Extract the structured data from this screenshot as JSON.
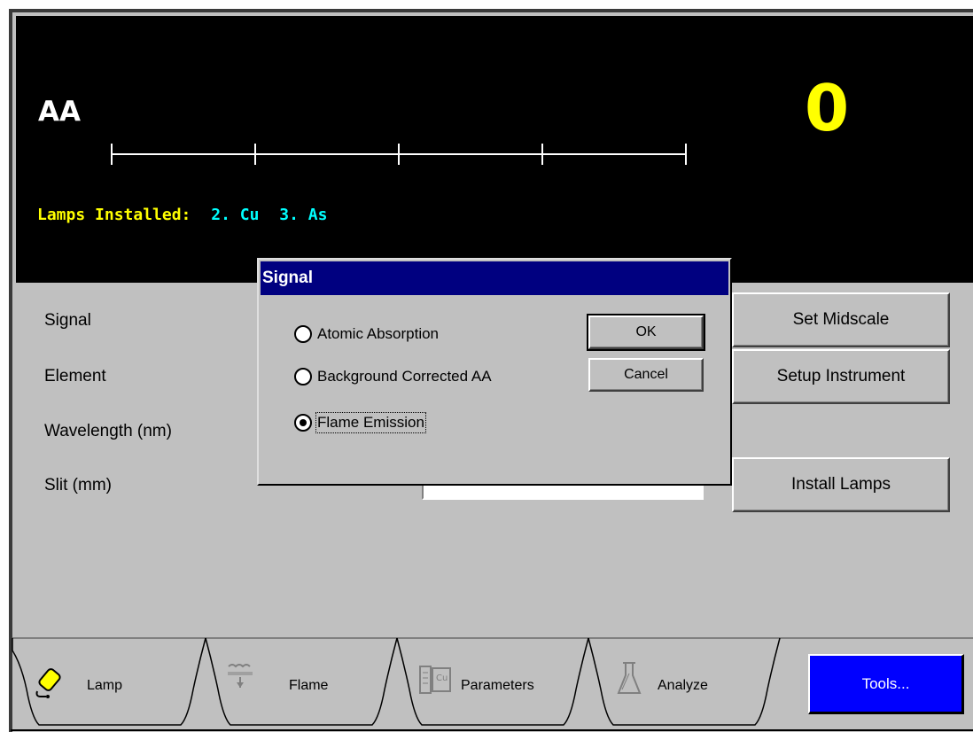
{
  "display": {
    "mode": "AA",
    "reading": "0",
    "lamps_label": "Lamps Installed:",
    "lamps": [
      "2. Cu",
      "3. As"
    ],
    "colors": {
      "background": "#000000",
      "label": "#ffff00",
      "lamp": "#00ffff",
      "mode": "#ffffff"
    }
  },
  "fields": {
    "signal": "Signal",
    "element": "Element",
    "wavelength": "Wavelength (nm)",
    "slit": "Slit (mm)"
  },
  "buttons": {
    "set_midscale": "Set Midscale",
    "setup_instrument": "Setup Instrument",
    "install_lamps": "Install Lamps",
    "tools": "Tools..."
  },
  "dialog": {
    "title": "Signal",
    "options": [
      {
        "label": "Atomic Absorption",
        "checked": false
      },
      {
        "label": "Background Corrected AA",
        "checked": false
      },
      {
        "label": "Flame Emission",
        "checked": true
      }
    ],
    "ok": "OK",
    "cancel": "Cancel",
    "title_color": "#000080"
  },
  "tabs": [
    {
      "label": "Lamp",
      "icon": "lamp-icon",
      "active": true
    },
    {
      "label": "Flame",
      "icon": "flame-icon",
      "active": false
    },
    {
      "label": "Parameters",
      "icon": "parameters-icon",
      "active": false
    },
    {
      "label": "Analyze",
      "icon": "flask-icon",
      "active": false
    }
  ],
  "tools_color": "#0000ff"
}
